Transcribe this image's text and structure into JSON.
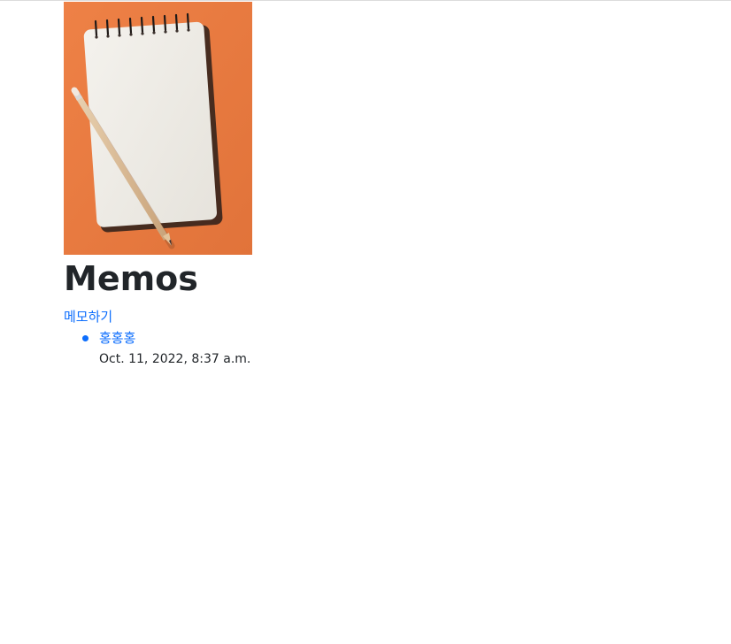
{
  "page": {
    "title": "Memos",
    "new_memo_link": "메모하기"
  },
  "colors": {
    "link": "#0d6efd",
    "text": "#212529",
    "image_background": "#e9793f"
  },
  "hero_image": {
    "description_icon": "notepad-with-pencil-image"
  },
  "memos": [
    {
      "title": "홍홍홍",
      "date": "Oct. 11, 2022, 8:37 a.m."
    }
  ]
}
